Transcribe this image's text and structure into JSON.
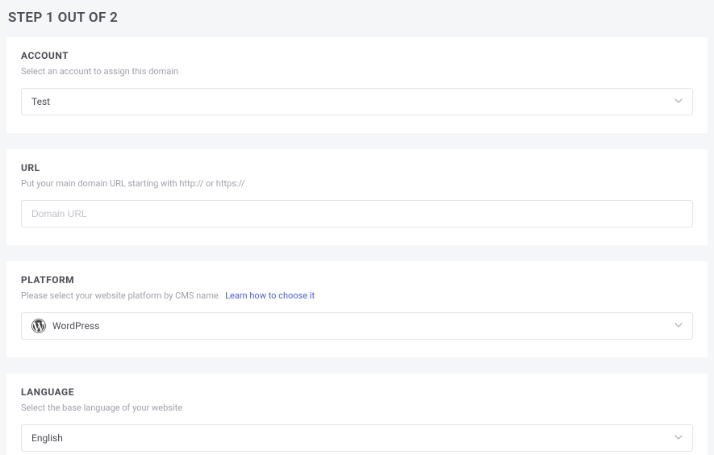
{
  "page": {
    "title": "STEP 1 OUT OF 2"
  },
  "account": {
    "label": "ACCOUNT",
    "description": "Select an account to assign this domain",
    "selected": "Test"
  },
  "url": {
    "label": "URL",
    "description": "Put your main domain URL starting with http:// or https://",
    "placeholder": "Domain URL",
    "value": ""
  },
  "platform": {
    "label": "PLATFORM",
    "description_prefix": "Please select your website platform by CMS name.",
    "link_text": "Learn how to choose it",
    "selected": "WordPress",
    "icon": "wordpress-icon"
  },
  "language": {
    "label": "LANGUAGE",
    "description": "Select the base language of your website",
    "selected": "English"
  }
}
